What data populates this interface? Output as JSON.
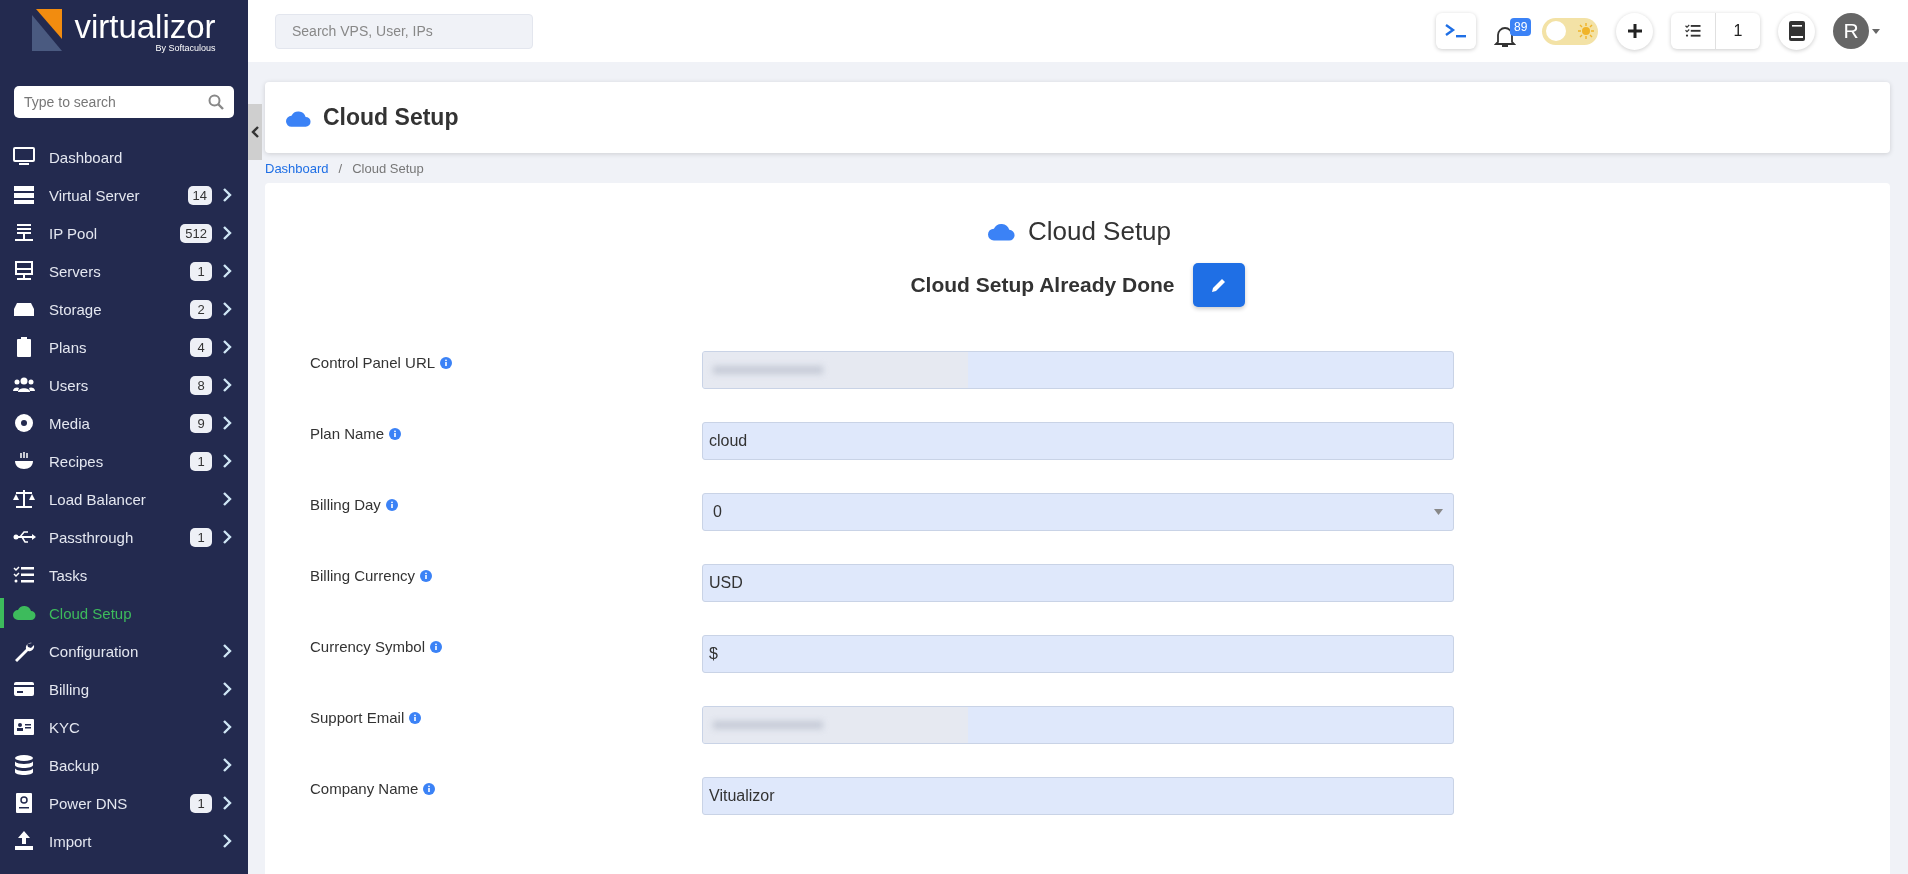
{
  "sidebar": {
    "logo": {
      "name": "virtualizor",
      "tagline": "By Softaculous"
    },
    "search": {
      "placeholder": "Type to search"
    },
    "items": [
      {
        "label": "Dashboard",
        "expandable": false,
        "selected": false
      },
      {
        "label": "Virtual Server",
        "badge": "14",
        "expandable": true,
        "selected": false
      },
      {
        "label": "IP Pool",
        "badge": "512",
        "expandable": true,
        "selected": false
      },
      {
        "label": "Servers",
        "badge": "1",
        "expandable": true,
        "selected": false
      },
      {
        "label": "Storage",
        "badge": "2",
        "expandable": true,
        "selected": false
      },
      {
        "label": "Plans",
        "badge": "4",
        "expandable": true,
        "selected": false
      },
      {
        "label": "Users",
        "badge": "8",
        "expandable": true,
        "selected": false
      },
      {
        "label": "Media",
        "badge": "9",
        "expandable": true,
        "selected": false
      },
      {
        "label": "Recipes",
        "badge": "1",
        "expandable": true,
        "selected": false
      },
      {
        "label": "Load Balancer",
        "expandable": true,
        "selected": false
      },
      {
        "label": "Passthrough",
        "badge": "1",
        "expandable": true,
        "selected": false
      },
      {
        "label": "Tasks",
        "expandable": false,
        "selected": false
      },
      {
        "label": "Cloud Setup",
        "expandable": false,
        "selected": true
      },
      {
        "label": "Configuration",
        "expandable": true,
        "selected": false
      },
      {
        "label": "Billing",
        "expandable": true,
        "selected": false
      },
      {
        "label": "KYC",
        "expandable": true,
        "selected": false
      },
      {
        "label": "Backup",
        "expandable": true,
        "selected": false
      },
      {
        "label": "Power DNS",
        "badge": "1",
        "expandable": true,
        "selected": false
      },
      {
        "label": "Import",
        "expandable": true,
        "selected": false
      }
    ]
  },
  "topbar": {
    "search": {
      "placeholder": "Search VPS, User, IPs"
    },
    "notifications": "89",
    "theme_toggle": {
      "on": false
    },
    "tasks_count": "1",
    "avatar": "R"
  },
  "page_header": {
    "title": "Cloud Setup"
  },
  "breadcrumb": [
    {
      "label": "Dashboard",
      "kind": "link"
    },
    {
      "label": "/",
      "kind": "separator"
    },
    {
      "label": "Cloud Setup",
      "kind": "current"
    }
  ],
  "card": {
    "title": "Cloud Setup",
    "status": "Cloud Setup Already Done",
    "fields": [
      {
        "label": "Control Panel URL",
        "kind": "redacted"
      },
      {
        "label": "Plan Name",
        "kind": "text",
        "value": "cloud"
      },
      {
        "label": "Billing Day",
        "kind": "select",
        "value": "0"
      },
      {
        "label": "Billing Currency",
        "kind": "text",
        "value": "USD"
      },
      {
        "label": "Currency Symbol",
        "kind": "text",
        "value": "$"
      },
      {
        "label": "Support Email",
        "kind": "redacted"
      },
      {
        "label": "Company Name",
        "kind": "text",
        "value": "Vitualizor"
      }
    ]
  }
}
